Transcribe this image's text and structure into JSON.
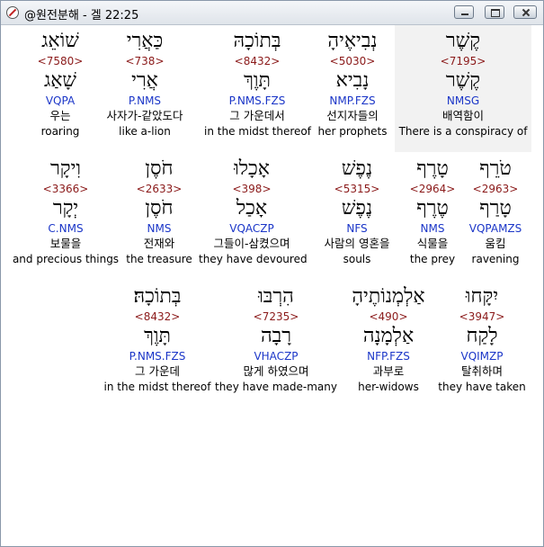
{
  "window": {
    "title": "@원전분해 - 겔 22:25"
  },
  "rows": [
    [
      {
        "heb": "שׁוֹאֵג",
        "num": "<7580>",
        "lex": "שָׁאַג",
        "morph": "VQPA",
        "kor": "우는",
        "eng": "roaring"
      },
      {
        "heb": "כַּאֲרִי",
        "num": "<738>",
        "lex": "אֲרִי",
        "morph": "P.NMS",
        "kor": "사자가-같았도다",
        "eng": "like a-lion"
      },
      {
        "heb": "בְּתוֹכָהּ",
        "num": "<8432>",
        "lex": "תָּוֶךְ",
        "morph": "P.NMS.FZS",
        "kor": "그 가운데서",
        "eng": "in the midst thereof"
      },
      {
        "heb": "נְבִיאֶיהָ",
        "num": "<5030>",
        "lex": "נָבִיא",
        "morph": "NMP.FZS",
        "kor": "선지자들의",
        "eng": "her prophets"
      },
      {
        "heb": "קֶשֶׁר",
        "num": "<7195>",
        "lex": "קֶשֶׁר",
        "morph": "NMSG",
        "kor": "배역함이",
        "eng": "There is a conspiracy of"
      }
    ],
    [
      {
        "heb": "וִיקָר",
        "num": "<3366>",
        "lex": "יְקָר",
        "morph": "C.NMS",
        "kor": "보물을",
        "eng": "and precious things"
      },
      {
        "heb": "חֹסֶן",
        "num": "<2633>",
        "lex": "חֹסֶן",
        "morph": "NMS",
        "kor": "전재와",
        "eng": "the treasure"
      },
      {
        "heb": "אָכָלוּ",
        "num": "<398>",
        "lex": "אָכַל",
        "morph": "VQACZP",
        "kor": "그들이-삼켰으며",
        "eng": "they have devoured"
      },
      {
        "heb": "נֶפֶשׁ",
        "num": "<5315>",
        "lex": "נֶפֶשׁ",
        "morph": "NFS",
        "kor": "사람의 영혼을",
        "eng": "souls"
      },
      {
        "heb": "טָרֶף",
        "num": "<2964>",
        "lex": "טֶרֶף",
        "morph": "NMS",
        "kor": "식물을",
        "eng": "the prey"
      },
      {
        "heb": "טֹרֵף",
        "num": "<2963>",
        "lex": "טָרַף",
        "morph": "VQPAMZS",
        "kor": "움킴",
        "eng": "ravening"
      }
    ],
    [
      {
        "heb": "בְּתוֹכָהּ׃",
        "num": "<8432>",
        "lex": "תָּוֶךְ",
        "morph": "P.NMS.FZS",
        "kor": "그 가운데",
        "eng": "in the midst thereof"
      },
      {
        "heb": "הִרְבּוּ",
        "num": "<7235>",
        "lex": "רָבָה",
        "morph": "VHACZP",
        "kor": "많게 하였으며",
        "eng": "they have made-many"
      },
      {
        "heb": "אַלְמְנוֹתֶיהָ",
        "num": "<490>",
        "lex": "אַלְמָנָה",
        "morph": "NFP.FZS",
        "kor": "과부로",
        "eng": "her-widows"
      },
      {
        "heb": "יִקָּחוּ",
        "num": "<3947>",
        "lex": "לָקַח",
        "morph": "VQIMZP",
        "kor": "탈취하며",
        "eng": "they have taken"
      }
    ]
  ]
}
